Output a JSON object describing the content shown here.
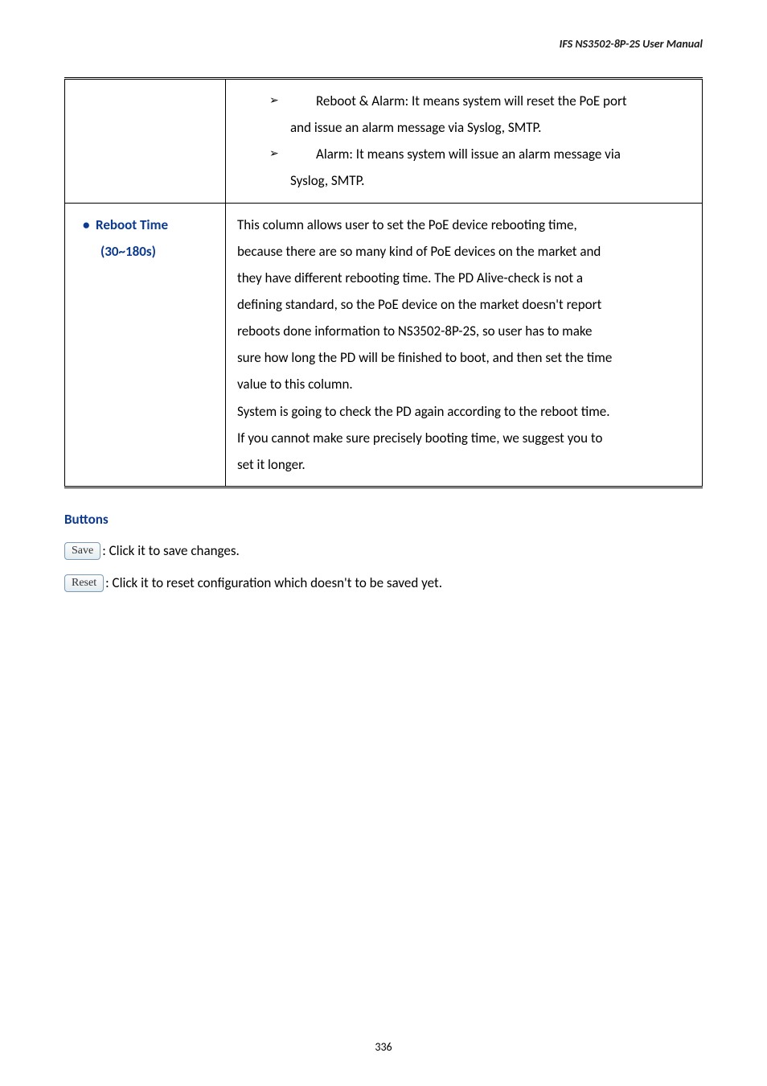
{
  "header": {
    "text": "IFS  NS3502-8P-2S  User  Manual"
  },
  "table": {
    "row1": {
      "b1_line1": "Reboot & Alarm: It means system will reset the PoE port",
      "b1_line2": "and issue an alarm message via Syslog, SMTP.",
      "b2_line1": "Alarm: It means system will issue an alarm message via",
      "b2_line2": "Syslog, SMTP."
    },
    "row2": {
      "label_line1": "Reboot Time",
      "label_line2": "(30~180s)",
      "p1": "This column allows user to set the PoE device rebooting time,",
      "p2": "because there are so many kind of PoE devices on the market and",
      "p3": "they have different rebooting time. The PD Alive-check is not a",
      "p4": "defining standard, so the PoE device on the market doesn't report",
      "p5": "reboots done information to NS3502-8P-2S, so user has to make",
      "p6": "sure how long the PD will be finished to boot, and then set the time",
      "p7": "value to this column.",
      "p8": "System is going to check the PD again according to the reboot time.",
      "p9": "If you cannot make sure precisely booting time, we suggest you to",
      "p10": "set it longer."
    }
  },
  "buttons_section": {
    "heading": "Buttons",
    "save_btn": "Save",
    "save_text": ": Click it to save changes.",
    "reset_btn": "Reset",
    "reset_text": ": Click it to reset configuration which doesn't to be saved yet."
  },
  "page_number": "336"
}
